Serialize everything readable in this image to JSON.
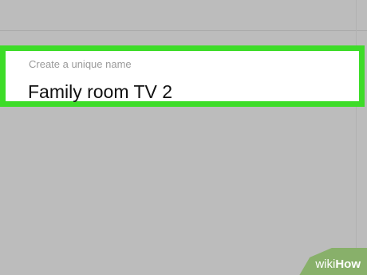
{
  "name_field": {
    "label": "Create a unique name",
    "value": "Family room TV 2"
  },
  "colors": {
    "background": "#bcbcbc",
    "highlight_border": "#3ddc28",
    "logo_leaf": "#88b06a"
  },
  "watermark": {
    "wiki": "wiki",
    "how": "How"
  }
}
